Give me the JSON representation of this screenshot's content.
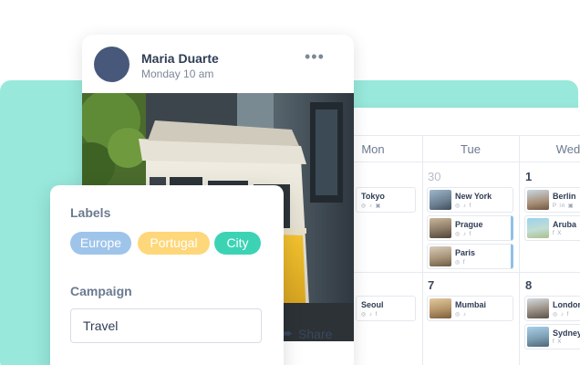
{
  "post_card": {
    "author": "Maria Duarte",
    "time": "Monday 10 am",
    "more_icon": "more-horizontal-icon",
    "share_label": "Share",
    "share_icon": "share-arrow-icon"
  },
  "labels_panel": {
    "labels_title": "Labels",
    "labels": [
      {
        "text": "Europe",
        "color": "#9fc4ea"
      },
      {
        "text": "Portugal",
        "color": "#fdd77a"
      },
      {
        "text": "City",
        "color": "#3cd3b5"
      }
    ],
    "campaign_title": "Campaign",
    "campaign_value": "Travel"
  },
  "calendar": {
    "days": [
      "Mon",
      "Tue",
      "Wed"
    ],
    "dates_row1": [
      "30",
      "1"
    ],
    "dates_row2": [
      "7",
      "8"
    ],
    "posts": [
      {
        "name": "Tokyo",
        "icons": "◎ ♪ ▣"
      },
      {
        "name": "New York",
        "icons": "◎ ♪ f"
      },
      {
        "name": "Prague",
        "icons": "◎ ♪ f"
      },
      {
        "name": "Paris",
        "icons": "◎ f"
      },
      {
        "name": "Berlin",
        "icons": "P in ▣"
      },
      {
        "name": "Aruba",
        "icons": "f X"
      },
      {
        "name": "Seoul",
        "icons": "◎ ♪ f"
      },
      {
        "name": "Mumbai",
        "icons": "◎ ♪"
      },
      {
        "name": "London",
        "icons": "◎ ♪ f"
      },
      {
        "name": "Sydney",
        "icons": "f X"
      }
    ]
  },
  "colors": {
    "teal_panel": "#98e8dc",
    "active_post_bar": "#8fbfe8"
  }
}
